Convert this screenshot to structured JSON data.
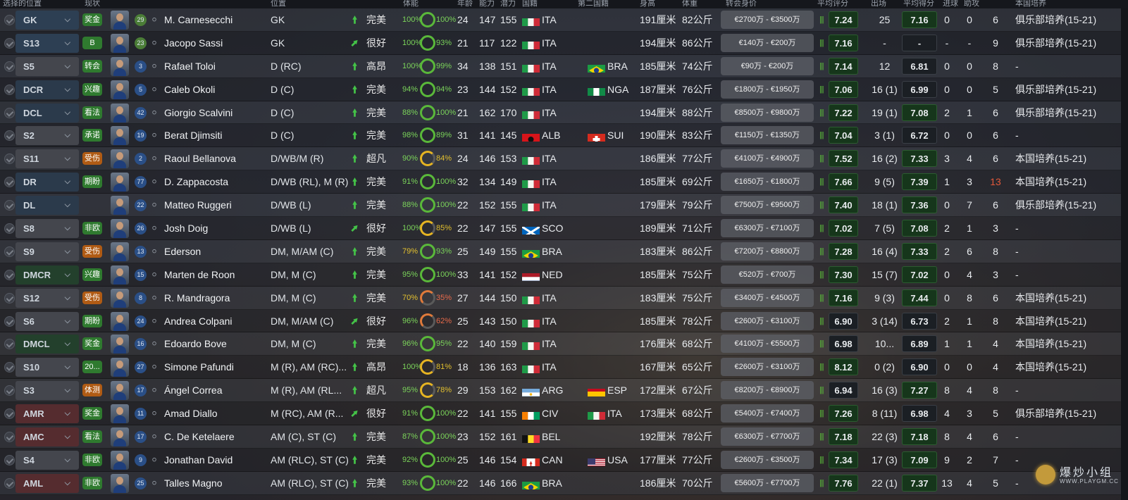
{
  "header": [
    {
      "text": "选择的位置"
    },
    {
      "text": "现状"
    },
    {
      "text": "位置"
    },
    {
      "text": "体能"
    },
    {
      "text": "年龄"
    },
    {
      "text": "能力"
    },
    {
      "text": "潜力"
    },
    {
      "text": "国籍"
    },
    {
      "text": "第二国籍"
    },
    {
      "text": "身高"
    },
    {
      "text": "体重"
    },
    {
      "text": "转会身价"
    },
    {
      "text": "平均评分"
    },
    {
      "text": "出场"
    },
    {
      "text": "平均得分"
    },
    {
      "text": "进球"
    },
    {
      "text": "助攻"
    },
    {
      "text": "本国培养"
    }
  ],
  "watermark": {
    "text": "爆炒小组",
    "url": "WWW.PLAYGM.CC"
  },
  "players": [
    {
      "slot": "GK",
      "slot_class": "gk",
      "badge": "奖金",
      "badge_color": "green",
      "num": "29",
      "num_class": "gk",
      "name": "M. Carnesecchi",
      "position": "GK",
      "arrow": "up",
      "form": "完美",
      "cond": "100%",
      "cond_class": "",
      "sharp": "100%",
      "sharp_class": "",
      "age": "24",
      "ca": "147",
      "pa": "155",
      "flag": "ITA",
      "nat": "ITA",
      "flag2": "",
      "nat2": "",
      "height": "191厘米",
      "weight": "82公斤",
      "value": "€2700万 - €3500万",
      "avg": "7.24",
      "avg_class": "",
      "apps": "25",
      "rating": "7.16",
      "rating_class": "",
      "goals": "0",
      "assists": "0",
      "extra": "6",
      "extra_class": "",
      "hg": "俱乐部培养(15-21)"
    },
    {
      "slot": "S13",
      "slot_class": "gk",
      "badge": "B",
      "badge_color": "green",
      "num": "23",
      "num_class": "gk",
      "name": "Jacopo Sassi",
      "position": "GK",
      "arrow": "diag",
      "form": "很好",
      "cond": "100%",
      "cond_class": "",
      "sharp": "93%",
      "sharp_class": "",
      "age": "21",
      "ca": "117",
      "pa": "122",
      "flag": "ITA",
      "nat": "ITA",
      "flag2": "",
      "nat2": "",
      "height": "194厘米",
      "weight": "86公斤",
      "value": "€140万 - €200万",
      "avg": "7.16",
      "avg_class": "",
      "apps": "-",
      "rating": "-",
      "rating_class": "dark",
      "goals": "-",
      "assists": "-",
      "extra": "9",
      "extra_class": "",
      "hg": "俱乐部培养(15-21)"
    },
    {
      "slot": "S5",
      "slot_class": "sub",
      "badge": "转会",
      "badge_color": "green",
      "num": "3",
      "num_class": "",
      "name": "Rafael Toloi",
      "position": "D (RC)",
      "arrow": "up",
      "form": "高昂",
      "cond": "100%",
      "cond_class": "",
      "sharp": "99%",
      "sharp_class": "",
      "age": "34",
      "ca": "138",
      "pa": "151",
      "flag": "ITA",
      "nat": "ITA",
      "flag2": "BRA",
      "nat2": "BRA",
      "height": "185厘米",
      "weight": "74公斤",
      "value": "€90万 - €200万",
      "avg": "7.14",
      "avg_class": "",
      "apps": "12",
      "rating": "6.81",
      "rating_class": "dark",
      "goals": "0",
      "assists": "0",
      "extra": "8",
      "extra_class": "",
      "hg": "-"
    },
    {
      "slot": "DCR",
      "slot_class": "def",
      "badge": "兴趣",
      "badge_color": "green",
      "num": "5",
      "num_class": "",
      "name": "Caleb Okoli",
      "position": "D (C)",
      "arrow": "up",
      "form": "完美",
      "cond": "94%",
      "cond_class": "",
      "sharp": "94%",
      "sharp_class": "",
      "age": "23",
      "ca": "144",
      "pa": "152",
      "flag": "ITA",
      "nat": "ITA",
      "flag2": "NGA",
      "nat2": "NGA",
      "height": "187厘米",
      "weight": "76公斤",
      "value": "€1800万 - €1950万",
      "avg": "7.06",
      "avg_class": "",
      "apps": "16 (1)",
      "rating": "6.99",
      "rating_class": "dark",
      "goals": "0",
      "assists": "0",
      "extra": "5",
      "extra_class": "",
      "hg": "俱乐部培养(15-21)"
    },
    {
      "slot": "DCL",
      "slot_class": "def",
      "badge": "看法",
      "badge_color": "green",
      "num": "42",
      "num_class": "",
      "name": "Giorgio Scalvini",
      "position": "D (C)",
      "arrow": "up",
      "form": "完美",
      "cond": "88%",
      "cond_class": "",
      "sharp": "100%",
      "sharp_class": "",
      "age": "21",
      "ca": "162",
      "pa": "170",
      "flag": "ITA",
      "nat": "ITA",
      "flag2": "",
      "nat2": "",
      "height": "194厘米",
      "weight": "88公斤",
      "value": "€8500万 - €9800万",
      "avg": "7.22",
      "avg_class": "",
      "apps": "19 (1)",
      "rating": "7.08",
      "rating_class": "",
      "goals": "2",
      "assists": "1",
      "extra": "6",
      "extra_class": "",
      "hg": "俱乐部培养(15-21)"
    },
    {
      "slot": "S2",
      "slot_class": "sub",
      "badge": "承诺",
      "badge_color": "green",
      "num": "19",
      "num_class": "",
      "name": "Berat Djimsiti",
      "position": "D (C)",
      "arrow": "up",
      "form": "完美",
      "cond": "98%",
      "cond_class": "",
      "sharp": "89%",
      "sharp_class": "",
      "age": "31",
      "ca": "141",
      "pa": "145",
      "flag": "ALB",
      "nat": "ALB",
      "flag2": "SUI",
      "nat2": "SUI",
      "height": "190厘米",
      "weight": "83公斤",
      "value": "€1150万 - €1350万",
      "avg": "7.04",
      "avg_class": "",
      "apps": "3 (1)",
      "rating": "6.72",
      "rating_class": "dark",
      "goals": "0",
      "assists": "0",
      "extra": "6",
      "extra_class": "",
      "hg": "-"
    },
    {
      "slot": "S11",
      "slot_class": "sub",
      "badge": "受伤",
      "badge_color": "orange",
      "num": "2",
      "num_class": "",
      "name": "Raoul Bellanova",
      "position": "D/WB/M (R)",
      "arrow": "up",
      "form": "超凡",
      "cond": "90%",
      "cond_class": "",
      "sharp": "84%",
      "sharp_class": "yellow",
      "age": "24",
      "ca": "146",
      "pa": "153",
      "flag": "ITA",
      "nat": "ITA",
      "flag2": "",
      "nat2": "",
      "height": "186厘米",
      "weight": "77公斤",
      "value": "€4100万 - €4900万",
      "avg": "7.52",
      "avg_class": "",
      "apps": "16 (2)",
      "rating": "7.33",
      "rating_class": "",
      "goals": "3",
      "assists": "4",
      "extra": "6",
      "extra_class": "",
      "hg": "本国培养(15-21)"
    },
    {
      "slot": "DR",
      "slot_class": "def",
      "badge": "期盼",
      "badge_color": "green",
      "num": "77",
      "num_class": "",
      "name": "D. Zappacosta",
      "position": "D/WB (RL), M (R)",
      "arrow": "up",
      "form": "完美",
      "cond": "91%",
      "cond_class": "",
      "sharp": "100%",
      "sharp_class": "",
      "age": "32",
      "ca": "134",
      "pa": "149",
      "flag": "ITA",
      "nat": "ITA",
      "flag2": "",
      "nat2": "",
      "height": "185厘米",
      "weight": "69公斤",
      "value": "€1650万 - €1800万",
      "avg": "7.66",
      "avg_class": "",
      "apps": "9 (5)",
      "rating": "7.39",
      "rating_class": "",
      "goals": "1",
      "assists": "3",
      "extra": "13",
      "extra_class": "red",
      "hg": "本国培养(15-21)"
    },
    {
      "slot": "DL",
      "slot_class": "def",
      "badge": "",
      "badge_color": "none",
      "num": "22",
      "num_class": "",
      "name": "Matteo Ruggeri",
      "position": "D/WB (L)",
      "arrow": "up",
      "form": "完美",
      "cond": "88%",
      "cond_class": "",
      "sharp": "100%",
      "sharp_class": "",
      "age": "22",
      "ca": "152",
      "pa": "155",
      "flag": "ITA",
      "nat": "ITA",
      "flag2": "",
      "nat2": "",
      "height": "179厘米",
      "weight": "79公斤",
      "value": "€7500万 - €9500万",
      "avg": "7.40",
      "avg_class": "",
      "apps": "18 (1)",
      "rating": "7.36",
      "rating_class": "",
      "goals": "0",
      "assists": "7",
      "extra": "6",
      "extra_class": "",
      "hg": "俱乐部培养(15-21)"
    },
    {
      "slot": "S8",
      "slot_class": "sub",
      "badge": "非欧",
      "badge_color": "green",
      "num": "26",
      "num_class": "",
      "name": "Josh Doig",
      "position": "D/WB (L)",
      "arrow": "diag",
      "form": "很好",
      "cond": "100%",
      "cond_class": "",
      "sharp": "85%",
      "sharp_class": "yellow",
      "age": "22",
      "ca": "147",
      "pa": "155",
      "flag": "SCO",
      "nat": "SCO",
      "flag2": "",
      "nat2": "",
      "height": "189厘米",
      "weight": "71公斤",
      "value": "€6300万 - €7100万",
      "avg": "7.02",
      "avg_class": "",
      "apps": "7 (5)",
      "rating": "7.08",
      "rating_class": "",
      "goals": "2",
      "assists": "1",
      "extra": "3",
      "extra_class": "",
      "hg": "-"
    },
    {
      "slot": "S9",
      "slot_class": "sub",
      "badge": "受伤",
      "badge_color": "orange",
      "num": "13",
      "num_class": "",
      "name": "Ederson",
      "position": "DM, M/AM (C)",
      "arrow": "up",
      "form": "完美",
      "cond": "79%",
      "cond_class": "yellow",
      "sharp": "93%",
      "sharp_class": "",
      "age": "25",
      "ca": "149",
      "pa": "155",
      "flag": "BRA",
      "nat": "BRA",
      "flag2": "",
      "nat2": "",
      "height": "183厘米",
      "weight": "86公斤",
      "value": "€7200万 - €8800万",
      "avg": "7.28",
      "avg_class": "",
      "apps": "16 (4)",
      "rating": "7.33",
      "rating_class": "",
      "goals": "2",
      "assists": "6",
      "extra": "8",
      "extra_class": "",
      "hg": "-"
    },
    {
      "slot": "DMCR",
      "slot_class": "mid",
      "badge": "兴趣",
      "badge_color": "green",
      "num": "15",
      "num_class": "",
      "name": "Marten de Roon",
      "position": "DM, M (C)",
      "arrow": "up",
      "form": "完美",
      "cond": "95%",
      "cond_class": "",
      "sharp": "100%",
      "sharp_class": "",
      "age": "33",
      "ca": "141",
      "pa": "152",
      "flag": "NED",
      "nat": "NED",
      "flag2": "",
      "nat2": "",
      "height": "185厘米",
      "weight": "75公斤",
      "value": "€520万 - €700万",
      "avg": "7.30",
      "avg_class": "",
      "apps": "15 (7)",
      "rating": "7.02",
      "rating_class": "",
      "goals": "0",
      "assists": "4",
      "extra": "3",
      "extra_class": "",
      "hg": "-"
    },
    {
      "slot": "S12",
      "slot_class": "sub",
      "badge": "受伤",
      "badge_color": "orange",
      "num": "8",
      "num_class": "",
      "name": "R. Mandragora",
      "position": "DM, M (C)",
      "arrow": "up",
      "form": "完美",
      "cond": "70%",
      "cond_class": "yellow",
      "sharp": "35%",
      "sharp_class": "red",
      "age": "27",
      "ca": "144",
      "pa": "150",
      "flag": "ITA",
      "nat": "ITA",
      "flag2": "",
      "nat2": "",
      "height": "183厘米",
      "weight": "75公斤",
      "value": "€3400万 - €4500万",
      "avg": "7.16",
      "avg_class": "",
      "apps": "9 (3)",
      "rating": "7.44",
      "rating_class": "",
      "goals": "0",
      "assists": "8",
      "extra": "6",
      "extra_class": "",
      "hg": "本国培养(15-21)"
    },
    {
      "slot": "S6",
      "slot_class": "sub",
      "badge": "期盼",
      "badge_color": "green",
      "num": "24",
      "num_class": "",
      "name": "Andrea Colpani",
      "position": "DM, M/AM (C)",
      "arrow": "diag",
      "form": "很好",
      "cond": "96%",
      "cond_class": "",
      "sharp": "62%",
      "sharp_class": "red",
      "age": "25",
      "ca": "143",
      "pa": "150",
      "flag": "ITA",
      "nat": "ITA",
      "flag2": "",
      "nat2": "",
      "height": "185厘米",
      "weight": "78公斤",
      "value": "€2600万 - €3100万",
      "avg": "6.90",
      "avg_class": "dark",
      "apps": "3 (14)",
      "rating": "6.73",
      "rating_class": "dark",
      "goals": "2",
      "assists": "1",
      "extra": "8",
      "extra_class": "",
      "hg": "本国培养(15-21)"
    },
    {
      "slot": "DMCL",
      "slot_class": "mid",
      "badge": "奖金",
      "badge_color": "green",
      "num": "16",
      "num_class": "",
      "name": "Edoardo Bove",
      "position": "DM, M (C)",
      "arrow": "up",
      "form": "完美",
      "cond": "96%",
      "cond_class": "",
      "sharp": "95%",
      "sharp_class": "",
      "age": "22",
      "ca": "140",
      "pa": "159",
      "flag": "ITA",
      "nat": "ITA",
      "flag2": "",
      "nat2": "",
      "height": "176厘米",
      "weight": "68公斤",
      "value": "€4100万 - €5500万",
      "avg": "6.98",
      "avg_class": "dark",
      "apps": "10...",
      "rating": "6.89",
      "rating_class": "dark",
      "goals": "1",
      "assists": "1",
      "extra": "4",
      "extra_class": "",
      "hg": "本国培养(15-21)"
    },
    {
      "slot": "S10",
      "slot_class": "sub",
      "badge": "20...",
      "badge_color": "green",
      "num": "27",
      "num_class": "",
      "name": "Simone Pafundi",
      "position": "M (R), AM (RC)...",
      "arrow": "up",
      "form": "高昂",
      "cond": "100%",
      "cond_class": "",
      "sharp": "81%",
      "sharp_class": "yellow",
      "age": "18",
      "ca": "136",
      "pa": "163",
      "flag": "ITA",
      "nat": "ITA",
      "flag2": "",
      "nat2": "",
      "height": "167厘米",
      "weight": "65公斤",
      "value": "€2600万 - €3100万",
      "avg": "8.12",
      "avg_class": "",
      "apps": "0 (2)",
      "rating": "6.90",
      "rating_class": "dark",
      "goals": "0",
      "assists": "0",
      "extra": "4",
      "extra_class": "",
      "hg": "本国培养(15-21)"
    },
    {
      "slot": "S3",
      "slot_class": "sub",
      "badge": "体测",
      "badge_color": "orange",
      "num": "17",
      "num_class": "",
      "name": "Ángel Correa",
      "position": "M (R), AM (RL...",
      "arrow": "up",
      "form": "超凡",
      "cond": "95%",
      "cond_class": "",
      "sharp": "78%",
      "sharp_class": "yellow",
      "age": "29",
      "ca": "153",
      "pa": "162",
      "flag": "ARG",
      "nat": "ARG",
      "flag2": "ESP",
      "nat2": "ESP",
      "height": "172厘米",
      "weight": "67公斤",
      "value": "€8200万 - €8900万",
      "avg": "6.94",
      "avg_class": "dark",
      "apps": "16 (3)",
      "rating": "7.27",
      "rating_class": "",
      "goals": "8",
      "assists": "4",
      "extra": "8",
      "extra_class": "",
      "hg": "-"
    },
    {
      "slot": "AMR",
      "slot_class": "att",
      "badge": "奖金",
      "badge_color": "green",
      "num": "11",
      "num_class": "",
      "name": "Amad Diallo",
      "position": "M (RC), AM (R...",
      "arrow": "diag",
      "form": "很好",
      "cond": "91%",
      "cond_class": "",
      "sharp": "100%",
      "sharp_class": "",
      "age": "22",
      "ca": "141",
      "pa": "155",
      "flag": "CIV",
      "nat": "CIV",
      "flag2": "ITA",
      "nat2": "ITA",
      "height": "173厘米",
      "weight": "68公斤",
      "value": "€5400万 - €7400万",
      "avg": "7.26",
      "avg_class": "",
      "apps": "8 (11)",
      "rating": "6.98",
      "rating_class": "dark",
      "goals": "4",
      "assists": "3",
      "extra": "5",
      "extra_class": "",
      "hg": "俱乐部培养(15-21)"
    },
    {
      "slot": "AMC",
      "slot_class": "att",
      "badge": "看法",
      "badge_color": "green",
      "num": "17",
      "num_class": "",
      "name": "C. De Ketelaere",
      "position": "AM (C), ST (C)",
      "arrow": "up",
      "form": "完美",
      "cond": "87%",
      "cond_class": "",
      "sharp": "100%",
      "sharp_class": "",
      "age": "23",
      "ca": "152",
      "pa": "161",
      "flag": "BEL",
      "nat": "BEL",
      "flag2": "",
      "nat2": "",
      "height": "192厘米",
      "weight": "78公斤",
      "value": "€6300万 - €7700万",
      "avg": "7.18",
      "avg_class": "",
      "apps": "22 (3)",
      "rating": "7.18",
      "rating_class": "",
      "goals": "8",
      "assists": "4",
      "extra": "6",
      "extra_class": "",
      "hg": "-"
    },
    {
      "slot": "S4",
      "slot_class": "sub",
      "badge": "非欧",
      "badge_color": "green",
      "num": "9",
      "num_class": "",
      "name": "Jonathan David",
      "position": "AM (RLC), ST (C)",
      "arrow": "up",
      "form": "完美",
      "cond": "92%",
      "cond_class": "",
      "sharp": "100%",
      "sharp_class": "",
      "age": "25",
      "ca": "146",
      "pa": "154",
      "flag": "CAN",
      "nat": "CAN",
      "flag2": "USA",
      "nat2": "USA",
      "height": "177厘米",
      "weight": "77公斤",
      "value": "€2600万 - €3500万",
      "avg": "7.34",
      "avg_class": "",
      "apps": "17 (3)",
      "rating": "7.09",
      "rating_class": "",
      "goals": "9",
      "assists": "2",
      "extra": "7",
      "extra_class": "",
      "hg": "-"
    },
    {
      "slot": "AML",
      "slot_class": "att",
      "badge": "非欧",
      "badge_color": "green",
      "num": "25",
      "num_class": "",
      "name": "Talles Magno",
      "position": "AM (RLC), ST (C)",
      "arrow": "up",
      "form": "完美",
      "cond": "93%",
      "cond_class": "",
      "sharp": "100%",
      "sharp_class": "",
      "age": "22",
      "ca": "146",
      "pa": "166",
      "flag": "BRA",
      "nat": "BRA",
      "flag2": "",
      "nat2": "",
      "height": "186厘米",
      "weight": "70公斤",
      "value": "€5600万 - €7700万",
      "avg": "7.76",
      "avg_class": "",
      "apps": "22 (1)",
      "rating": "7.37",
      "rating_class": "",
      "goals": "13",
      "assists": "4",
      "extra": "5",
      "extra_class": "",
      "hg": "-"
    }
  ]
}
